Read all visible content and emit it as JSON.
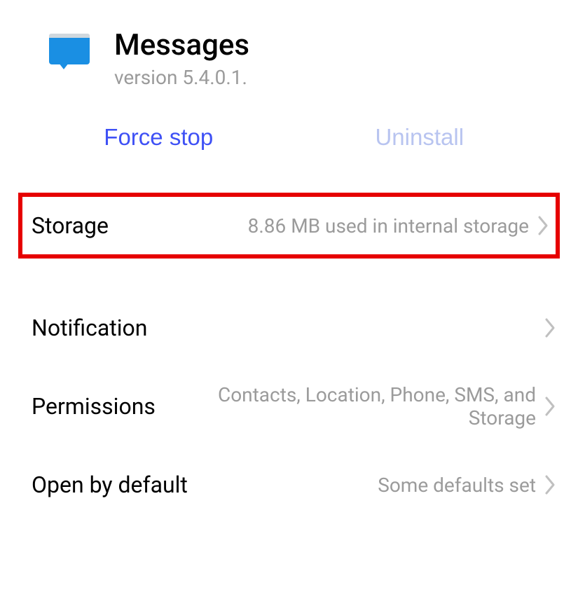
{
  "header": {
    "app_name": "Messages",
    "version_label": "version 5.4.0.1."
  },
  "actions": {
    "force_stop": "Force stop",
    "uninstall": "Uninstall"
  },
  "settings": {
    "storage": {
      "label": "Storage",
      "value": "8.86 MB used in internal storage"
    },
    "notification": {
      "label": "Notification",
      "value": ""
    },
    "permissions": {
      "label": "Permissions",
      "value": "Contacts, Location, Phone, SMS, and Storage"
    },
    "open_by_default": {
      "label": "Open by default",
      "value": "Some defaults set"
    }
  }
}
